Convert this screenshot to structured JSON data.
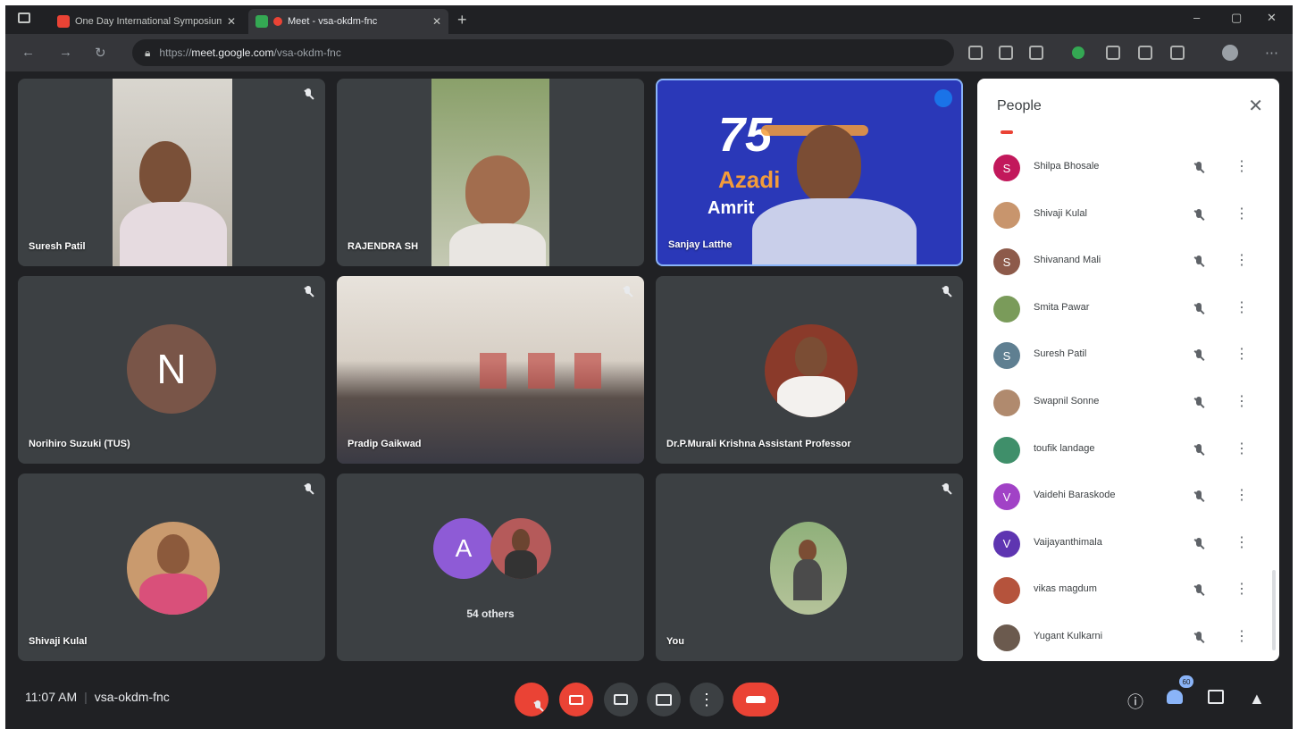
{
  "browser": {
    "tabs": [
      {
        "title": "One Day International Symposium",
        "favicon_color": "#ea4335"
      },
      {
        "title": "Meet - vsa-okdm-fnc",
        "favicon_color": "#34a853"
      }
    ],
    "new_tab": "+",
    "url_prefix": "https://",
    "url_host": "meet.google.com",
    "url_path": "/vsa-okdm-fnc",
    "window_controls": [
      "–",
      "▢",
      "✕"
    ]
  },
  "tiles": [
    {
      "name": "Suresh Patil",
      "muted": true
    },
    {
      "name": "RAJENDRA SH",
      "muted": false
    },
    {
      "name": "Sanjay Latthe",
      "muted": false,
      "speaking": true,
      "background": {
        "line1": "75",
        "line2": "Azadi",
        "line3": "Amrit"
      }
    },
    {
      "name": "Norihiro Suzuki (TUS)",
      "muted": true,
      "avatar_letter": "N"
    },
    {
      "name": "Pradip Gaikwad",
      "muted": true
    },
    {
      "name": "Dr.P.Murali Krishna Assistant Professor",
      "muted": true
    },
    {
      "name": "Shivaji Kulal",
      "muted": true
    },
    {
      "name": "",
      "others_label": "54 others",
      "avatar_letter": "A"
    },
    {
      "name": "You",
      "muted": true
    }
  ],
  "people": {
    "title": "People",
    "close": "✕",
    "list": [
      {
        "name": "Shilpa Bhosale",
        "initial": "S",
        "color": "#c2185b"
      },
      {
        "name": "Shivaji Kulal",
        "initial": "",
        "color": "#c8956d"
      },
      {
        "name": "Shivanand Mali",
        "initial": "S",
        "color": "#8d5a4a"
      },
      {
        "name": "Smita Pawar",
        "initial": "",
        "color": "#7a9b5a"
      },
      {
        "name": "Suresh Patil",
        "initial": "S",
        "color": "#5f7f91"
      },
      {
        "name": "Swapnil Sonne",
        "initial": "",
        "color": "#b08a6e"
      },
      {
        "name": "toufik landage",
        "initial": "",
        "color": "#3f8f6a"
      },
      {
        "name": "Vaidehi Baraskode",
        "initial": "V",
        "color": "#a142c6"
      },
      {
        "name": "Vaijayanthimala",
        "initial": "V",
        "color": "#5e35b1"
      },
      {
        "name": "vikas magdum",
        "initial": "",
        "color": "#b5533c"
      },
      {
        "name": "Yugant Kulkarni",
        "initial": "",
        "color": "#6b5a4e"
      }
    ]
  },
  "bottom": {
    "time": "11:07 AM",
    "separator": "|",
    "meeting_code": "vsa-okdm-fnc",
    "participant_count": "60"
  }
}
